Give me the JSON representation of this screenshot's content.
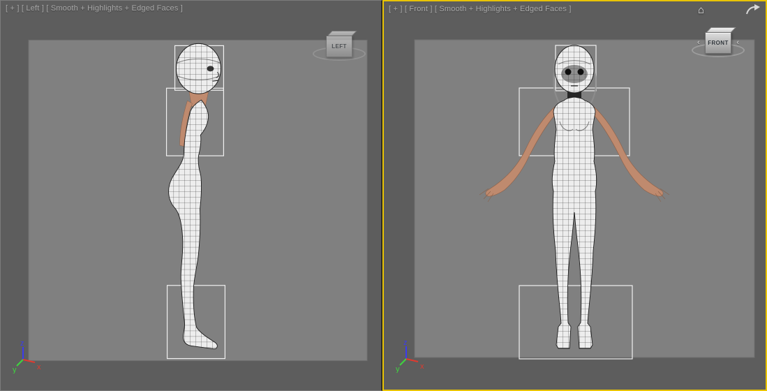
{
  "viewports": [
    {
      "label": "[ + ] [ Left ] [ Smooth + Highlights + Edged Faces ]",
      "viewcube": "LEFT",
      "active": false
    },
    {
      "label": "[ + ] [ Front ] [ Smooth + Highlights + Edged Faces ]",
      "viewcube": "FRONT",
      "active": true
    }
  ],
  "axis": {
    "x": "x",
    "y": "y",
    "z": "z"
  },
  "icons": {
    "home_glyph": "⌂",
    "chevron_left_glyph": "‹",
    "chevron_right_glyph": "‹"
  },
  "colors": {
    "active_border": "#e9c402",
    "viewport_bg": "#5d5d5d",
    "plane_bg": "#808080",
    "label_text": "#a9a9a9",
    "axis_x": "#e03a2f",
    "axis_y": "#3fd43f",
    "axis_z": "#3b3bee",
    "skin": "#bf8a6e",
    "bracket": "#f0f0f0"
  }
}
